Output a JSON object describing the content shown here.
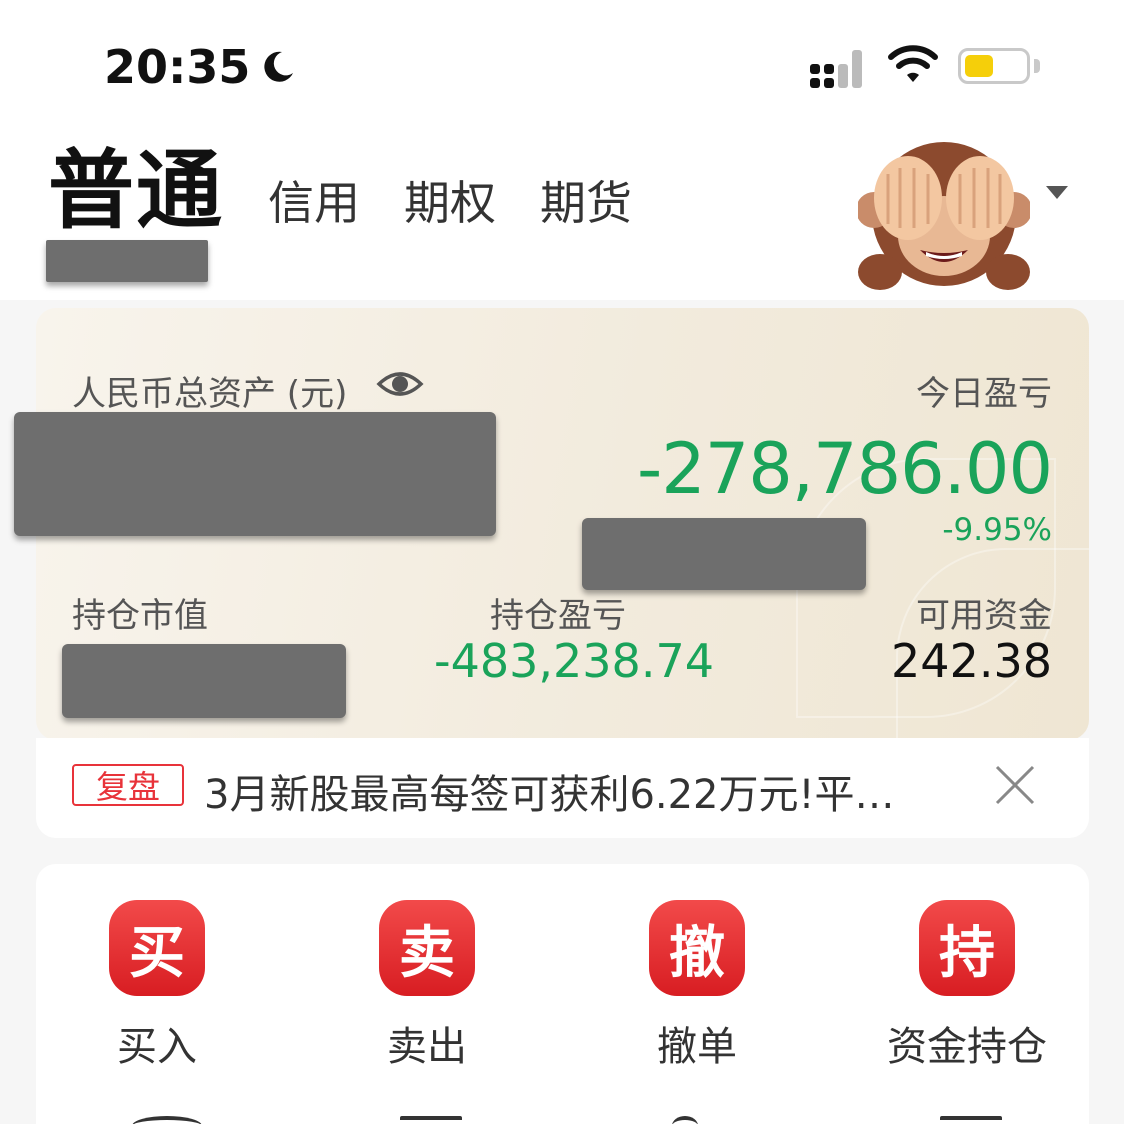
{
  "status": {
    "time": "20:35"
  },
  "tabs": {
    "active": "普通",
    "items": [
      "信用",
      "期权",
      "期货"
    ]
  },
  "asset": {
    "total_label": "人民币总资产 (元)",
    "today_pl_label": "今日盈亏",
    "today_pl_value": "-278,786.00",
    "today_pl_pct": "-9.95%",
    "position_value_label": "持仓市值",
    "position_pl_label": "持仓盈亏",
    "position_pl_value": "-483,238.74",
    "cash_label": "可用资金",
    "cash_value": "242.38",
    "colors": {
      "loss": "#1aa35a"
    }
  },
  "notice": {
    "badge": "复盘",
    "text": "3月新股最高每签可获利6.22万元!平…"
  },
  "actions": [
    {
      "icon": "买",
      "label": "买入"
    },
    {
      "icon": "卖",
      "label": "卖出"
    },
    {
      "icon": "撤",
      "label": "撤单"
    },
    {
      "icon": "持",
      "label": "资金持仓"
    }
  ]
}
